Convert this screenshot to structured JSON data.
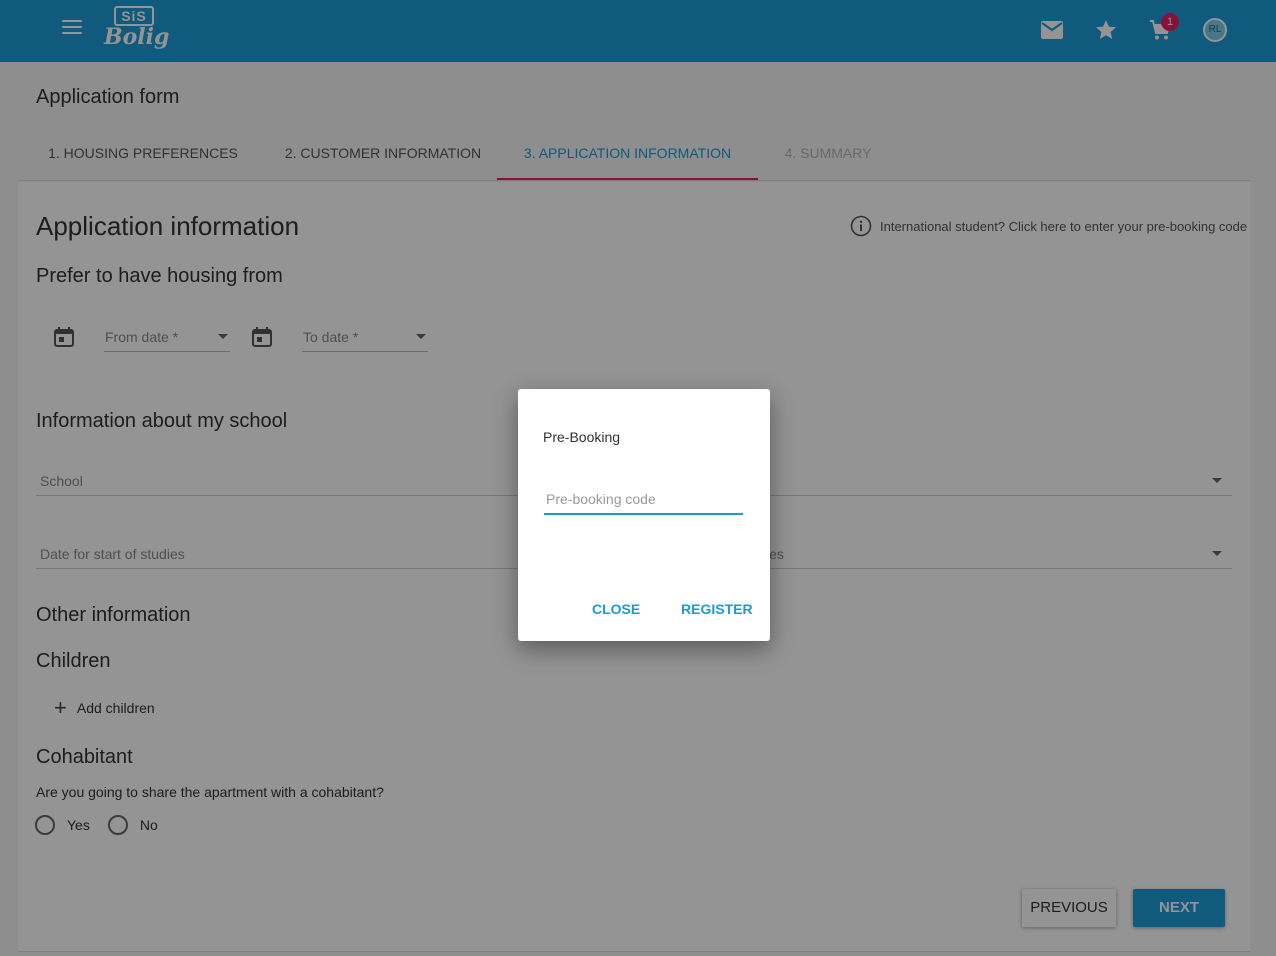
{
  "header": {
    "logo_top": "SiS",
    "logo_bottom": "Bolig",
    "cart_count": "1",
    "avatar_initials": "RL",
    "icons": [
      "menu-icon",
      "mail-icon",
      "star-icon",
      "cart-icon"
    ],
    "background_color": "#1a9bd7"
  },
  "page": {
    "title": "Application form"
  },
  "tabs": [
    {
      "label": "1. Housing preferences",
      "state": "done"
    },
    {
      "label": "2. Customer information",
      "state": "done"
    },
    {
      "label": "3. Application information",
      "state": "active"
    },
    {
      "label": "4. Summary",
      "state": "disabled"
    }
  ],
  "application": {
    "heading": "Application information",
    "info_link": "International student? Click here to enter your pre-booking code",
    "housing_from": {
      "heading": "Prefer to have housing from",
      "from_placeholder": "From date *",
      "to_placeholder": "To date *"
    },
    "school": {
      "heading": "Information about my school",
      "school_placeholder": "School",
      "start_placeholder": "Date for start of studies",
      "end_placeholder_partial": "ies"
    },
    "other": {
      "heading": "Other information",
      "children_heading": "Children",
      "add_children": "Add children",
      "cohabitant_heading": "Cohabitant",
      "cohabitant_question": "Are you going to share the apartment with a cohabitant?",
      "options": [
        "Yes",
        "No"
      ]
    },
    "buttons": {
      "previous": "Previous",
      "next": "Next"
    }
  },
  "dialog": {
    "title": "Pre-Booking",
    "input_placeholder": "Pre-booking code",
    "input_value": "",
    "close": "Close",
    "register": "Register",
    "accent_color": "#1a9bd7"
  }
}
